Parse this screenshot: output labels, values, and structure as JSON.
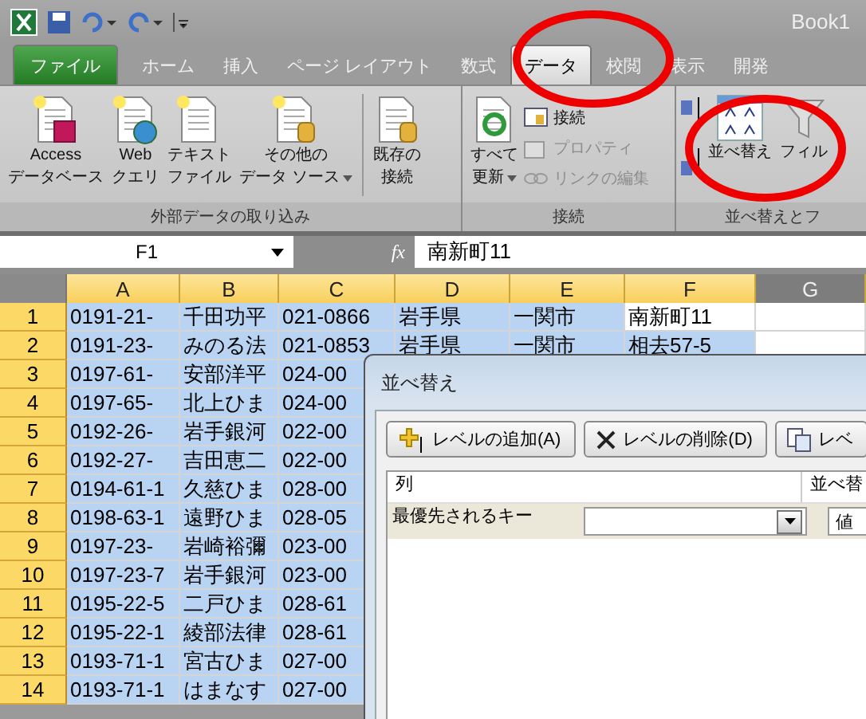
{
  "title_bar": {
    "title": "Book1"
  },
  "ribbon_tabs": [
    {
      "label": "ファイル",
      "kind": "file",
      "selected": false
    },
    {
      "label": "ホーム",
      "kind": "tab",
      "selected": false
    },
    {
      "label": "挿入",
      "kind": "tab",
      "selected": false
    },
    {
      "label": "ページ レイアウト",
      "kind": "tab",
      "selected": false
    },
    {
      "label": "数式",
      "kind": "tab",
      "selected": false
    },
    {
      "label": "データ",
      "kind": "tab",
      "selected": true
    },
    {
      "label": "校閲",
      "kind": "tab",
      "selected": false
    },
    {
      "label": "表示",
      "kind": "tab",
      "selected": false
    },
    {
      "label": "開発",
      "kind": "tab",
      "selected": false
    }
  ],
  "ribbon_groups": [
    {
      "label": "外部データの取り込み",
      "commands": [
        {
          "kind": "large",
          "lines": [
            "Access",
            "データベース"
          ],
          "dropdown": false
        },
        {
          "kind": "large",
          "lines": [
            "Web",
            "クエリ"
          ],
          "dropdown": false
        },
        {
          "kind": "large",
          "lines": [
            "テキスト",
            "ファイル"
          ],
          "dropdown": false
        },
        {
          "kind": "large",
          "lines": [
            "その他の",
            "データ ソース"
          ],
          "dropdown": true
        },
        {
          "kind": "separator"
        },
        {
          "kind": "large",
          "lines": [
            "既存の",
            "接続"
          ],
          "dropdown": false
        }
      ]
    },
    {
      "label": "接続",
      "commands": [
        {
          "kind": "large",
          "lines": [
            "すべて",
            "更新"
          ],
          "dropdown": true
        },
        {
          "kind": "small",
          "label": "接続",
          "disabled": false
        },
        {
          "kind": "small",
          "label": "プロパティ",
          "disabled": true
        },
        {
          "kind": "small",
          "label": "リンクの編集",
          "disabled": true
        }
      ]
    },
    {
      "label": "並べ替えとフ",
      "commands": [
        {
          "kind": "iconstack"
        },
        {
          "kind": "large",
          "lines": [
            "並べ替え"
          ],
          "dropdown": false
        },
        {
          "kind": "large",
          "lines": [
            "フィル"
          ],
          "dropdown": false
        }
      ]
    }
  ],
  "formula_bar": {
    "name_box": "F1",
    "function_label": "fx",
    "value": "南新町11"
  },
  "sheet": {
    "columns": [
      {
        "label": "A",
        "highlighted": true
      },
      {
        "label": "B",
        "highlighted": true
      },
      {
        "label": "C",
        "highlighted": true
      },
      {
        "label": "D",
        "highlighted": true
      },
      {
        "label": "E",
        "highlighted": true
      },
      {
        "label": "F",
        "highlighted": true
      },
      {
        "label": "G",
        "highlighted": false
      }
    ],
    "rows": [
      {
        "number": "1",
        "cells": [
          {
            "text": "0191-21-",
            "selected": true
          },
          {
            "text": "千田功平",
            "selected": true
          },
          {
            "text": "021-0866",
            "selected": true
          },
          {
            "text": "岩手県",
            "selected": true
          },
          {
            "text": "一関市",
            "selected": true
          },
          {
            "text": "南新町11",
            "selected": false
          }
        ]
      },
      {
        "number": "2",
        "cells": [
          {
            "text": "0191-23-",
            "selected": true
          },
          {
            "text": "みのる法",
            "selected": true
          },
          {
            "text": "021-0853",
            "selected": true
          },
          {
            "text": "岩手県",
            "selected": true
          },
          {
            "text": "一関市",
            "selected": true
          },
          {
            "text": "相去57-5",
            "selected": true
          }
        ]
      },
      {
        "number": "3",
        "cells": [
          {
            "text": "0197-61-",
            "selected": true
          },
          {
            "text": "安部洋平",
            "selected": true
          },
          {
            "text": "024-00",
            "selected": true
          }
        ]
      },
      {
        "number": "4",
        "cells": [
          {
            "text": "0197-65-",
            "selected": true
          },
          {
            "text": "北上ひま",
            "selected": true
          },
          {
            "text": "024-00",
            "selected": true
          }
        ]
      },
      {
        "number": "5",
        "cells": [
          {
            "text": "0192-26-",
            "selected": true
          },
          {
            "text": "岩手銀河",
            "selected": true
          },
          {
            "text": "022-00",
            "selected": true
          }
        ]
      },
      {
        "number": "6",
        "cells": [
          {
            "text": "0192-27-",
            "selected": true
          },
          {
            "text": "吉田恵二",
            "selected": true
          },
          {
            "text": "022-00",
            "selected": true
          }
        ]
      },
      {
        "number": "7",
        "cells": [
          {
            "text": "0194-61-1",
            "selected": true
          },
          {
            "text": "久慈ひま",
            "selected": true
          },
          {
            "text": "028-00",
            "selected": true
          }
        ]
      },
      {
        "number": "8",
        "cells": [
          {
            "text": "0198-63-1",
            "selected": true
          },
          {
            "text": "遠野ひま",
            "selected": true
          },
          {
            "text": "028-05",
            "selected": true
          }
        ]
      },
      {
        "number": "9",
        "cells": [
          {
            "text": "0197-23-",
            "selected": true
          },
          {
            "text": "岩崎裕彌",
            "selected": true
          },
          {
            "text": "023-00",
            "selected": true
          }
        ]
      },
      {
        "number": "10",
        "cells": [
          {
            "text": "0197-23-7",
            "selected": true
          },
          {
            "text": "岩手銀河",
            "selected": true
          },
          {
            "text": "023-00",
            "selected": true
          }
        ]
      },
      {
        "number": "11",
        "cells": [
          {
            "text": "0195-22-5",
            "selected": true
          },
          {
            "text": "二戸ひま",
            "selected": true
          },
          {
            "text": "028-61",
            "selected": true
          }
        ]
      },
      {
        "number": "12",
        "cells": [
          {
            "text": "0195-22-1",
            "selected": true
          },
          {
            "text": "綾部法律",
            "selected": true
          },
          {
            "text": "028-61",
            "selected": true
          }
        ]
      },
      {
        "number": "13",
        "cells": [
          {
            "text": "0193-71-1",
            "selected": true
          },
          {
            "text": "宮古ひま",
            "selected": true
          },
          {
            "text": "027-00",
            "selected": true
          }
        ]
      },
      {
        "number": "14",
        "cells": [
          {
            "text": "0193-71-1",
            "selected": true
          },
          {
            "text": "はまなす",
            "selected": true
          },
          {
            "text": "027-00",
            "selected": true
          }
        ]
      }
    ]
  },
  "sort_dialog": {
    "title": "並べ替え",
    "buttons": [
      "レベルの追加(A)",
      "レベルの削除(D)",
      "レベ"
    ],
    "headers": [
      "列",
      "並べ替"
    ],
    "levels": [
      {
        "label": "最優先されるキー",
        "sort_on": "値"
      }
    ]
  }
}
